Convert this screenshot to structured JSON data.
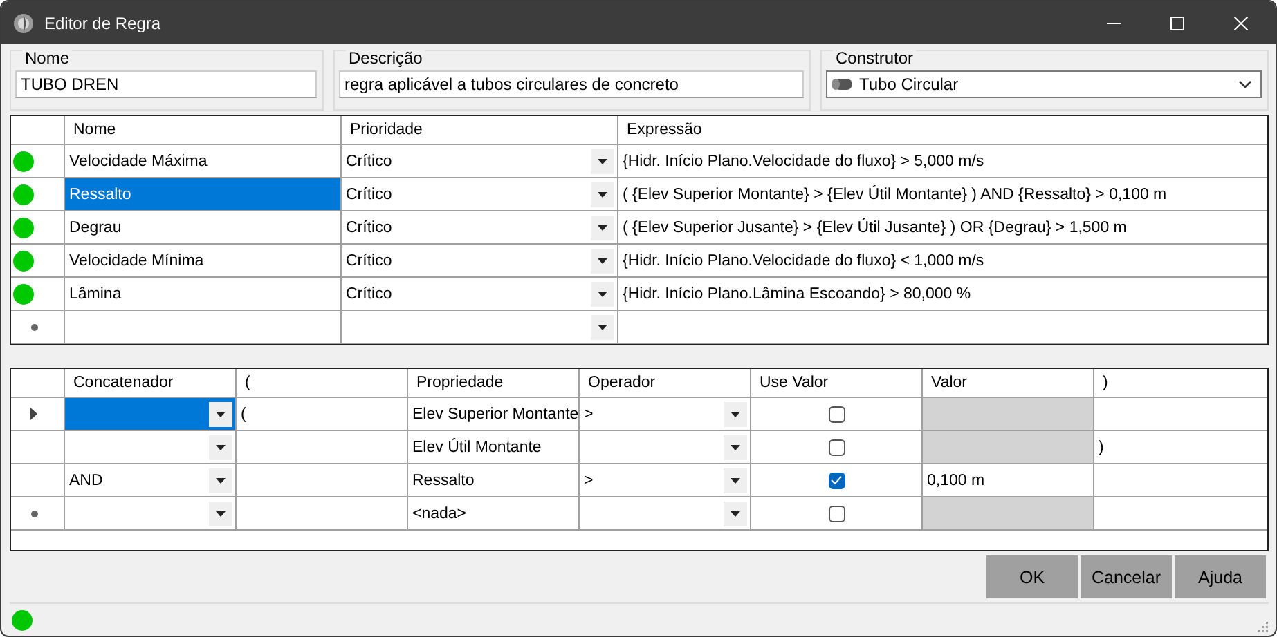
{
  "window": {
    "title": "Editor de Regra"
  },
  "fields": [
    {
      "kind": "text",
      "label": "Nome",
      "value": "TUBO DREN"
    },
    {
      "kind": "text",
      "label": "Descrição",
      "value": "regra aplicável a tubos circulares de concreto"
    },
    {
      "kind": "combo",
      "label": "Construtor",
      "value": "Tubo Circular"
    }
  ],
  "rules": {
    "columns": [
      "Nome",
      "Prioridade",
      "Expressão"
    ],
    "rows": [
      {
        "kind": "rule",
        "color": "#00c800",
        "name": "Velocidade Máxima",
        "selected": false,
        "priority": "Crítico",
        "expression": "{Hidr. Início Plano.Velocidade do fluxo} > 5,000 m/s"
      },
      {
        "kind": "rule",
        "color": "#00c800",
        "name": "Ressalto",
        "selected": true,
        "priority": "Crítico",
        "expression": "( {Elev Superior Montante} >  {Elev Útil Montante} )  AND {Ressalto} > 0,100 m"
      },
      {
        "kind": "rule",
        "color": "#00c800",
        "name": "Degrau",
        "selected": false,
        "priority": "Crítico",
        "expression": "( {Elev Superior Jusante} >  {Elev Útil Jusante} )  OR {Degrau} > 1,500 m"
      },
      {
        "kind": "rule",
        "color": "#00c800",
        "name": "Velocidade Mínima",
        "selected": false,
        "priority": "Crítico",
        "expression": "{Hidr. Início Plano.Velocidade do fluxo} < 1,000 m/s"
      },
      {
        "kind": "rule",
        "color": "#00c800",
        "name": "Lâmina",
        "selected": false,
        "priority": "Crítico",
        "expression": "{Hidr. Início Plano.Lâmina Escoando} > 80,000 %"
      },
      {
        "kind": "new"
      }
    ]
  },
  "conditions": {
    "columns": [
      "Concatenador",
      "(",
      "Propriedade",
      "Operador",
      "Use Valor",
      "Valor",
      ")"
    ],
    "rows": [
      {
        "kind": "condition",
        "current": true,
        "selected": true,
        "open": "(",
        "property": "Elev Superior Montante",
        "operator": ">",
        "checked": false
      },
      {
        "kind": "condition",
        "current": false,
        "selected": false,
        "property": "Elev Útil Montante",
        "checked": false,
        "close": ")"
      },
      {
        "kind": "condition",
        "current": false,
        "selected": false,
        "concat": "AND",
        "property": "Ressalto",
        "operator": ">",
        "checked": true,
        "value": "0,100 m"
      },
      {
        "kind": "new",
        "property": "<nada>",
        "checked": false
      }
    ]
  },
  "buttons": [
    "OK",
    "Cancelar",
    "Ajuda"
  ],
  "status_bar": {
    "color": "#00c800"
  }
}
